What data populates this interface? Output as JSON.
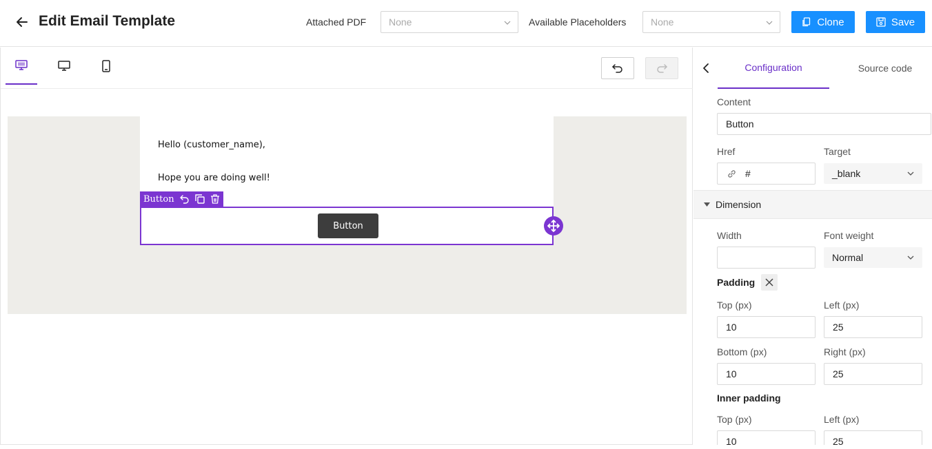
{
  "header": {
    "title": "Edit Email Template",
    "attached_pdf_label": "Attached PDF",
    "attached_pdf_value": "None",
    "placeholders_label": "Available Placeholders",
    "placeholders_value": "None",
    "clone_label": "Clone",
    "save_label": "Save",
    "primary_color": "#1890ff"
  },
  "toolbar": {
    "view_modes": [
      "preview-icon",
      "desktop-icon",
      "mobile-icon"
    ],
    "active_view": "preview-icon",
    "accent_color": "#6a2fc8"
  },
  "email": {
    "greeting": "Hello (customer_name),",
    "line2": "Hope you are doing well!",
    "button_label": "Button",
    "selection_label": "Button"
  },
  "panel": {
    "tabs": {
      "configuration": "Configuration",
      "source_code": "Source code"
    },
    "active_tab": "configuration",
    "content_label": "Content",
    "content_value": "Button",
    "href_label": "Href",
    "href_value": "#",
    "target_label": "Target",
    "target_value": "_blank",
    "dimension_label": "Dimension",
    "width_label": "Width",
    "width_value": "",
    "font_weight_label": "Font weight",
    "font_weight_value": "Normal",
    "padding_label": "Padding",
    "padding": {
      "top_label": "Top (px)",
      "top_value": "10",
      "left_label": "Left (px)",
      "left_value": "25",
      "bottom_label": "Bottom (px)",
      "bottom_value": "10",
      "right_label": "Right (px)",
      "right_value": "25"
    },
    "inner_padding_label": "Inner padding",
    "inner_padding": {
      "top_label": "Top (px)",
      "top_value": "10",
      "left_label": "Left (px)",
      "left_value": "25"
    }
  }
}
